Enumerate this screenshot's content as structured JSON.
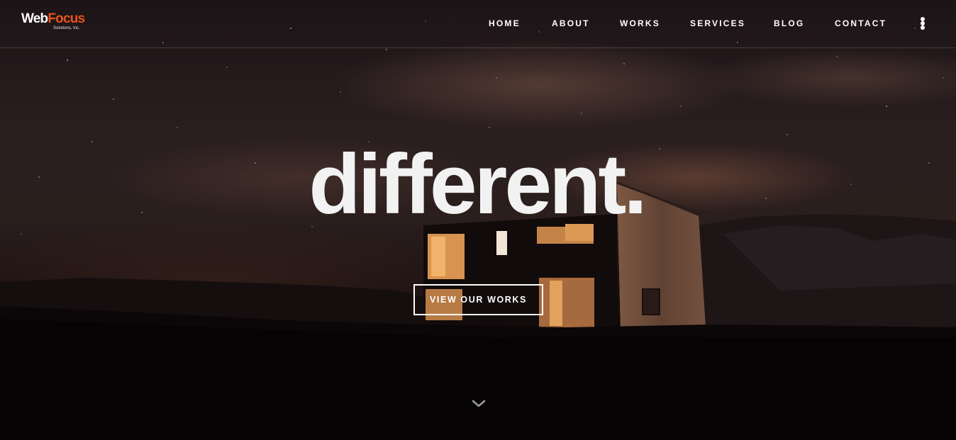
{
  "logo": {
    "web": "Web",
    "focus": "Focus",
    "subtitle": "Solutions, Inc."
  },
  "nav": {
    "items": [
      {
        "label": "HOME"
      },
      {
        "label": "ABOUT"
      },
      {
        "label": "WORKS"
      },
      {
        "label": "SERVICES"
      },
      {
        "label": "BLOG"
      },
      {
        "label": "CONTACT"
      }
    ],
    "menu_icon": "vertical-dots-icon"
  },
  "hero": {
    "headline": "different.",
    "cta_label": "VIEW OUR WORKS",
    "scroll_icon": "chevron-down-icon"
  },
  "colors": {
    "brand_accent": "#e8541c",
    "text": "#ffffff"
  }
}
